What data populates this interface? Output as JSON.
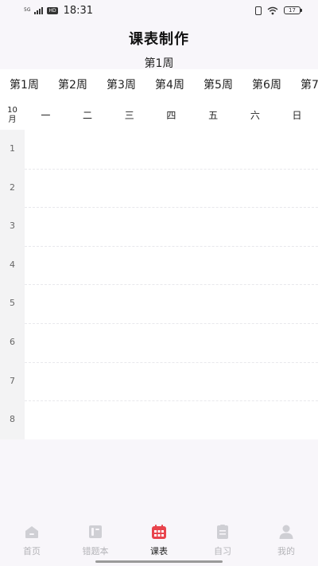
{
  "status_bar": {
    "network": "5G",
    "hd": "HD",
    "time": "18:31",
    "battery": "17"
  },
  "header": {
    "title": "课表制作",
    "current_week": "第1周"
  },
  "week_tabs": [
    "第1周",
    "第2周",
    "第3周",
    "第4周",
    "第5周",
    "第6周",
    "第7周"
  ],
  "grid": {
    "month_number": "10",
    "month_unit": "月",
    "days": [
      "一",
      "二",
      "三",
      "四",
      "五",
      "六",
      "日"
    ],
    "periods": [
      "1",
      "2",
      "3",
      "4",
      "5",
      "6",
      "7",
      "8"
    ]
  },
  "bottom_nav": {
    "items": [
      {
        "label": "首页",
        "icon": "home-icon",
        "active": false
      },
      {
        "label": "错题本",
        "icon": "notebook-icon",
        "active": false
      },
      {
        "label": "课表",
        "icon": "calendar-icon",
        "active": true
      },
      {
        "label": "自习",
        "icon": "clipboard-icon",
        "active": false
      },
      {
        "label": "我的",
        "icon": "profile-icon",
        "active": false
      }
    ]
  },
  "colors": {
    "accent": "#e8434c",
    "inactive_icon": "#cfcfd4",
    "period_column": "#f3f3f4",
    "page_background": "#f8f6fa"
  }
}
